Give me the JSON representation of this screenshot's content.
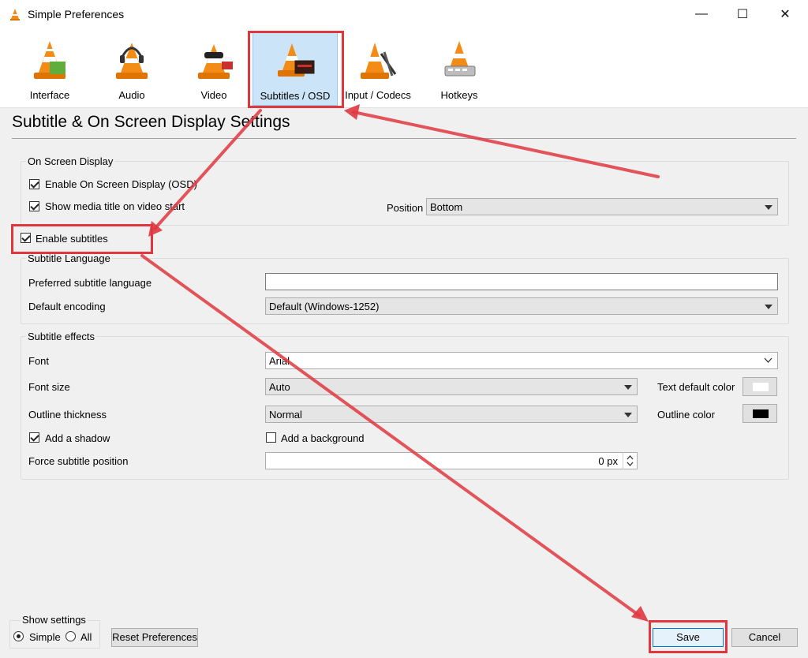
{
  "window": {
    "title": "Simple Preferences",
    "minimize_glyph": "—",
    "maximize_glyph": "☐",
    "close_glyph": "✕"
  },
  "tabs": [
    {
      "label": "Interface",
      "icon": "vlc-cone-icon"
    },
    {
      "label": "Audio",
      "icon": "vlc-headphones-icon"
    },
    {
      "label": "Video",
      "icon": "vlc-video-icon"
    },
    {
      "label": "Subtitles / OSD",
      "icon": "vlc-subtitles-icon",
      "selected": true
    },
    {
      "label": "Input / Codecs",
      "icon": "vlc-codecs-icon"
    },
    {
      "label": "Hotkeys",
      "icon": "vlc-hotkeys-icon"
    }
  ],
  "page_title": "Subtitle & On Screen Display Settings",
  "osd": {
    "group_title": "On Screen Display",
    "enable_osd": {
      "label": "Enable On Screen Display (OSD)",
      "checked": true
    },
    "show_title": {
      "label": "Show media title on video start",
      "checked": true
    },
    "position_label": "Position",
    "position_value": "Bottom"
  },
  "enable_subtitles": {
    "label": "Enable subtitles",
    "checked": true
  },
  "language": {
    "group_title": "Subtitle Language",
    "preferred_label": "Preferred subtitle language",
    "preferred_value": "",
    "encoding_label": "Default encoding",
    "encoding_value": "Default (Windows-1252)"
  },
  "effects": {
    "group_title": "Subtitle effects",
    "font_label": "Font",
    "font_value": "Arial",
    "size_label": "Font size",
    "size_value": "Auto",
    "text_color_label": "Text default color",
    "text_color": "#ffffff",
    "outline_label": "Outline thickness",
    "outline_value": "Normal",
    "outline_color_label": "Outline color",
    "outline_color": "#000000",
    "shadow": {
      "label": "Add a shadow",
      "checked": true
    },
    "background": {
      "label": "Add a background",
      "checked": false
    },
    "force_pos_label": "Force subtitle position",
    "force_pos_value": "0 px"
  },
  "footer": {
    "show_settings_label": "Show settings",
    "simple_label": "Simple",
    "all_label": "All",
    "reset_label": "Reset Preferences",
    "save_label": "Save",
    "cancel_label": "Cancel"
  },
  "annotation_color": "#e0373f"
}
